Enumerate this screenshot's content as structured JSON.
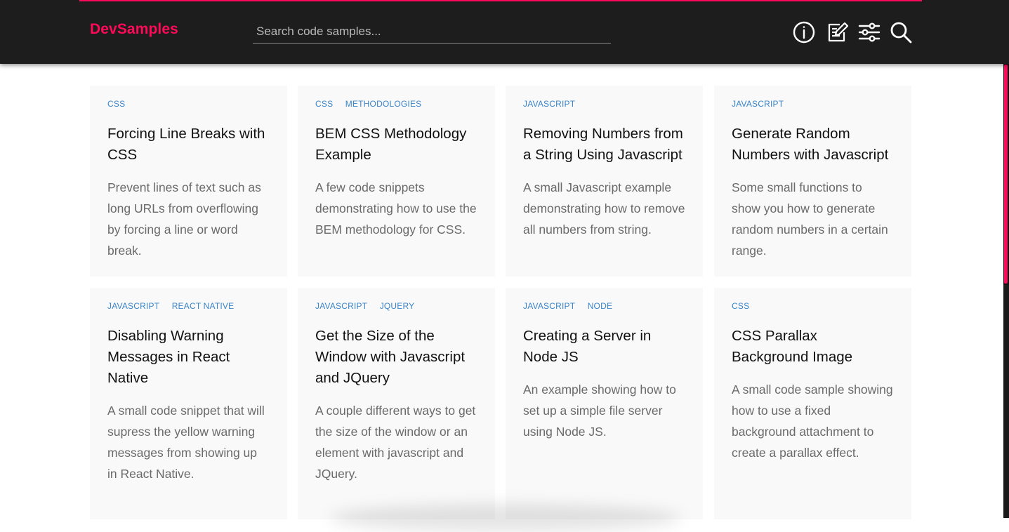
{
  "colors": {
    "accent": "#ff0a5a",
    "tag": "#3a84c8",
    "header_bg": "#1d1d1d"
  },
  "header": {
    "logo": "DevSamples",
    "search": {
      "placeholder": "Search code samples...",
      "value": ""
    },
    "icons": [
      "info-icon",
      "edit-icon",
      "sliders-icon",
      "search-icon"
    ]
  },
  "cards": [
    {
      "tags": [
        "CSS"
      ],
      "title": "Forcing Line Breaks with CSS",
      "description": "Prevent lines of text such as long URLs from overflowing by forcing a line or word break."
    },
    {
      "tags": [
        "CSS",
        "METHODOLOGIES"
      ],
      "title": "BEM CSS Methodology Example",
      "description": "A few code snippets demonstrating how to use the BEM methodology for CSS."
    },
    {
      "tags": [
        "JAVASCRIPT"
      ],
      "title": "Removing Numbers from a String Using Javascript",
      "description": "A small Javascript example demonstrating how to remove all numbers from string."
    },
    {
      "tags": [
        "JAVASCRIPT"
      ],
      "title": "Generate Random Numbers with Javascript",
      "description": "Some small functions to show you how to generate random numbers in a certain range."
    },
    {
      "tags": [
        "JAVASCRIPT",
        "REACT NATIVE"
      ],
      "title": "Disabling Warning Messages in React Native",
      "description": "A small code snippet that will supress the yellow warning messages from showing up in React Native."
    },
    {
      "tags": [
        "JAVASCRIPT",
        "JQUERY"
      ],
      "title": "Get the Size of the Window with Javascript and JQuery",
      "description": "A couple different ways to get the size of the window or an element with javascript and JQuery."
    },
    {
      "tags": [
        "JAVASCRIPT",
        "NODE"
      ],
      "title": "Creating a Server in Node JS",
      "description": "An example showing how to set up a simple file server using Node JS."
    },
    {
      "tags": [
        "CSS"
      ],
      "title": "CSS Parallax Background Image",
      "description": "A small code sample showing how to use a fixed background attachment to create a parallax effect."
    }
  ]
}
